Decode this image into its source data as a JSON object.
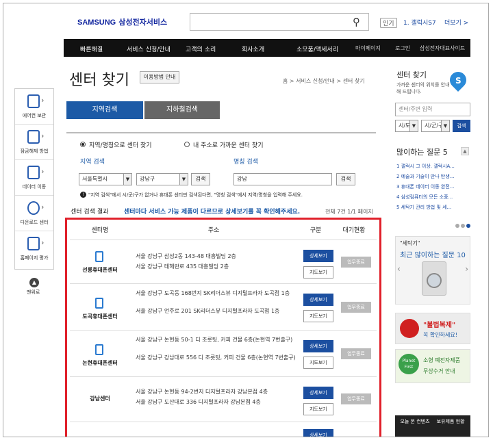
{
  "header": {
    "logo_brand": "SAMSUNG",
    "logo_service": "삼성전자서비스",
    "popular_badge": "인기",
    "popular_word": "1. 갤럭시S7",
    "more_link": "더보기 >"
  },
  "nav": [
    "빠른해결",
    "서비스 신청/안내",
    "고객의 소리",
    "회사소개",
    "소모품/액세서리",
    "마이페이지",
    "로그인",
    "삼성전자대표사이트"
  ],
  "quickbar": [
    "에어컨 보관",
    "잠금해제 방법",
    "데이터 이동",
    "다운로드 센터",
    "홈페이지 평가"
  ],
  "quickbar_top": "맨위로",
  "page": {
    "title": "센터 찾기",
    "howto_button": "이용방법 안내",
    "breadcrumb": "홈 > 서비스 신청/안내 > 센터 찾기"
  },
  "tabs": [
    "지역검색",
    "지하철검색"
  ],
  "search": {
    "radio_region": "지역/명칭으로 센터 찾기",
    "radio_near": "내 주소로 가까운 센터 찾기",
    "region_label": "지역 검색",
    "name_label": "명칭 검색",
    "city": "서울특별시",
    "district": "강남구",
    "search_button": "검색",
    "name_value": "강남",
    "note": "\"지역 검색\"에서 시/군/구가 없거나 휴대폰 센터만 검색된다면, \"명칭 검색\"에서 지역/명칭을 입력해 주세요."
  },
  "results": {
    "label": "센터 검색 결과",
    "message": "센터마다 서비스 가능 제품이 다르므로 상세보기를 꼭 확인해주세요.",
    "count": "전체 7건 1/1 페이지",
    "headers": [
      "센터명",
      "주소",
      "구분",
      "대기현황"
    ],
    "detail_button": "상세보기",
    "map_button": "지도보기",
    "status": "업무종료",
    "rows": [
      {
        "name": "선릉휴대폰센터",
        "addr1": "서울 강남구 삼성2동 143-48 대흥빌딩 2층",
        "addr2": "서울 강남구 테헤란로 435 대흥빌딩 2층"
      },
      {
        "name": "도곡휴대폰센터",
        "addr1": "서울 강남구 도곡동 168번지 SK리더스뷰 디지털프라자 도곡점 1층",
        "addr2": "서울 강남구 언주로 201 SK리더스뷰 디지털프라자 도곡점 1층"
      },
      {
        "name": "논현휴대폰센터",
        "addr1": "서울 강남구 논현동 50-1 디 조릇팃, 커피 건물 6층(논현역 7번출구)",
        "addr2": "서울 강남구 강남대로 556 디 조릇팃, 커피 건물 6층(논현역 7번출구)"
      },
      {
        "name": "강남센터",
        "addr1": "서울 강남구 논현동 94-2번지 디지털프라자 강남본점 4층",
        "addr2": "서울 강남구 도산대로 336 디지털프라자 강남본점 4층"
      }
    ]
  },
  "right": {
    "title": "센터 찾기",
    "desc": "가까운 센터의 위치를 안내해 드립니다.",
    "input_placeholder": "센터/주변 입력",
    "sido": "시/도",
    "gungu": "시/군/구",
    "search_button": "검색",
    "faq_title": "많이하는 질문 5",
    "faq": [
      "1 갤럭시 그 이상. 갤럭시A...",
      "2 예술과 기술이 만나 탄생...",
      "3 휴대폰 데이터 이동 완전...",
      "4 삼성컴퓨터의 모든 소중...",
      "5 세탁기 관리 방법 및 세..."
    ],
    "banner1_tag": "\"세탁기\"",
    "banner1_title": "최근 많이하는 질문 10",
    "banner2_title": "\"불법복제\"",
    "banner2_sub": "꼭 확인하세요!",
    "banner3_logo": "Planet First",
    "banner3_title": "소형 폐전자제품",
    "banner3_sub": "무상수거 안내",
    "bottom1": "오늘 본 컨텐츠",
    "bottom2": "보유제품 현황"
  }
}
